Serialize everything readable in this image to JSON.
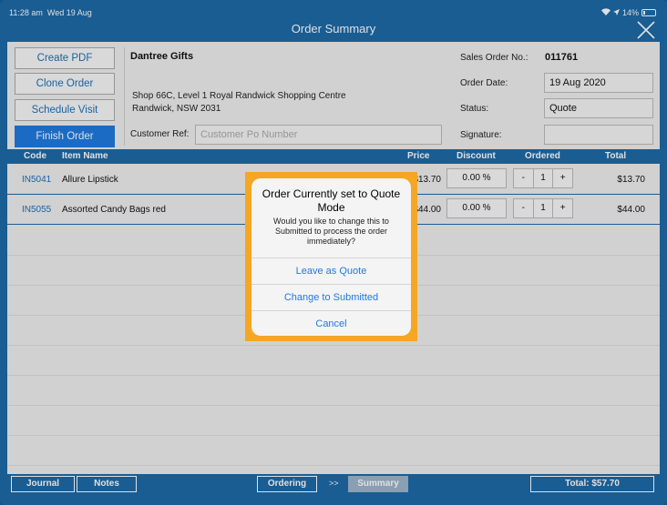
{
  "status": {
    "time": "11:28 am",
    "date": "Wed 19 Aug",
    "battery": "14%"
  },
  "window": {
    "title": "Order Summary"
  },
  "side_buttons": {
    "create_pdf": "Create PDF",
    "clone_order": "Clone Order",
    "schedule_visit": "Schedule Visit",
    "finish_order": "Finish Order"
  },
  "customer": {
    "name": "Dantree Gifts",
    "address_line1": "Shop 66C, Level 1  Royal Randwick Shopping Centre",
    "address_line2": "Randwick, NSW 2031",
    "ref_label": "Customer Ref:",
    "ref_placeholder": "Customer Po Number"
  },
  "order": {
    "so_label": "Sales Order No.:",
    "so_value": "011761",
    "date_label": "Order Date:",
    "date_value": "19 Aug 2020",
    "status_label": "Status:",
    "status_value": "Quote",
    "signature_label": "Signature:"
  },
  "table": {
    "headers": {
      "code": "Code",
      "item": "Item Name",
      "price": "Price",
      "discount": "Discount",
      "ordered": "Ordered",
      "total": "Total"
    },
    "rows": [
      {
        "code": "IN5041",
        "name": "Allure Lipstick",
        "price": "$13.70",
        "discount": "0.00 %",
        "minus": "-",
        "qty": "1",
        "plus": "+",
        "total": "$13.70"
      },
      {
        "code": "IN5055",
        "name": "Assorted Candy Bags red",
        "price": "$44.00",
        "discount": "0.00 %",
        "minus": "-",
        "qty": "1",
        "plus": "+",
        "total": "$44.00"
      }
    ]
  },
  "bottom": {
    "journal": "Journal",
    "notes": "Notes",
    "ordering": "Ordering",
    "arrows": ">>",
    "summary": "Summary",
    "total": "Total: $57.70"
  },
  "dialog": {
    "title": "Order Currently set to Quote Mode",
    "message": "Would you like to change this to Submitted to process the order immediately?",
    "actions": [
      "Leave as Quote",
      "Change to Submitted",
      "Cancel"
    ]
  }
}
